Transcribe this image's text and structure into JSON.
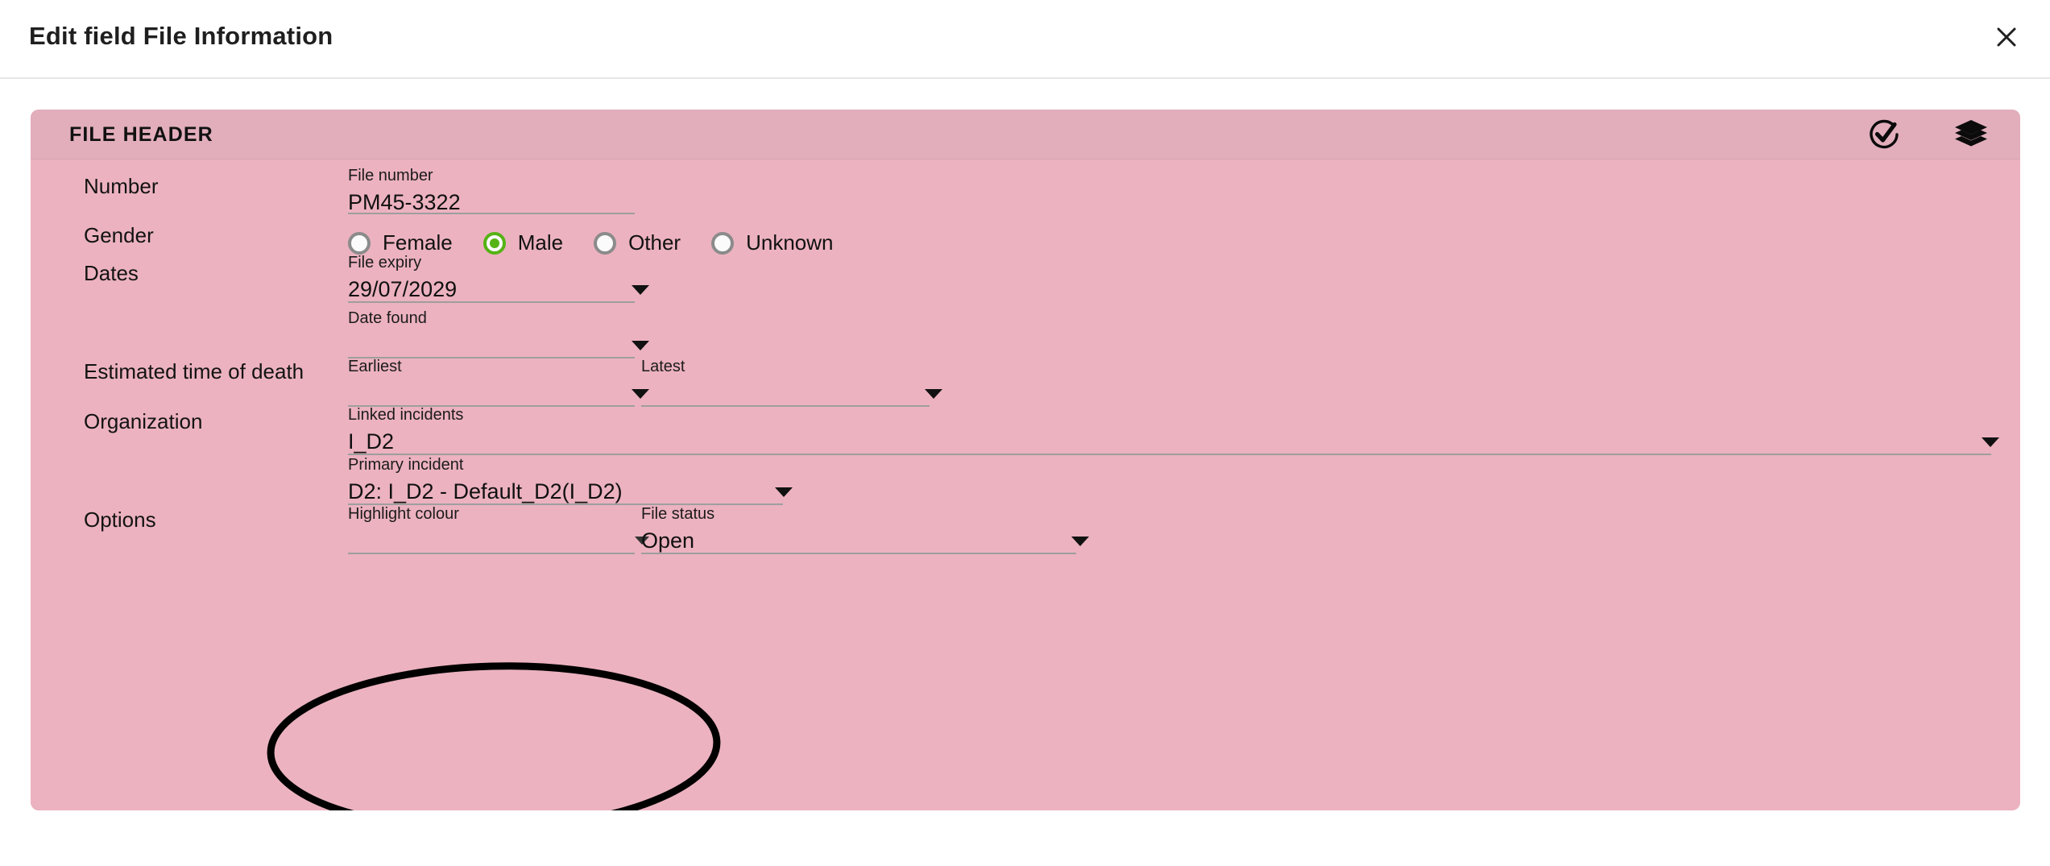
{
  "dialog": {
    "title": "Edit field File Information",
    "close_icon": "close-icon"
  },
  "card": {
    "header_title": "FILE HEADER",
    "icons": [
      {
        "name": "check-circle-icon"
      },
      {
        "name": "layers-icon"
      }
    ]
  },
  "rows": {
    "number": {
      "label": "Number",
      "file_number": {
        "label": "File number",
        "value": "PM45-3322"
      }
    },
    "gender": {
      "label": "Gender",
      "options": [
        {
          "label": "Female",
          "checked": false
        },
        {
          "label": "Male",
          "checked": true
        },
        {
          "label": "Other",
          "checked": false
        },
        {
          "label": "Unknown",
          "checked": false
        }
      ]
    },
    "dates": {
      "label": "Dates",
      "file_expiry": {
        "label": "File expiry",
        "value": "29/07/2029"
      },
      "date_found": {
        "label": "Date found",
        "value": ""
      }
    },
    "etd": {
      "label": "Estimated time of death",
      "earliest": {
        "label": "Earliest",
        "value": ""
      },
      "latest": {
        "label": "Latest",
        "value": ""
      }
    },
    "organization": {
      "label": "Organization",
      "linked_incidents": {
        "label": "Linked incidents",
        "value": "I_D2"
      },
      "primary_incident": {
        "label": "Primary incident",
        "value": "D2: I_D2 - Default_D2(I_D2)"
      }
    },
    "options": {
      "label": "Options",
      "highlight_colour": {
        "label": "Highlight colour",
        "value": ""
      },
      "file_status": {
        "label": "File status",
        "value": "Open"
      }
    }
  },
  "colors": {
    "card_body": "#ecb2c0",
    "card_header": "#e2aebc",
    "radio_selected": "#55b314",
    "underline": "#9e9e9e",
    "annotation": "#000000"
  }
}
